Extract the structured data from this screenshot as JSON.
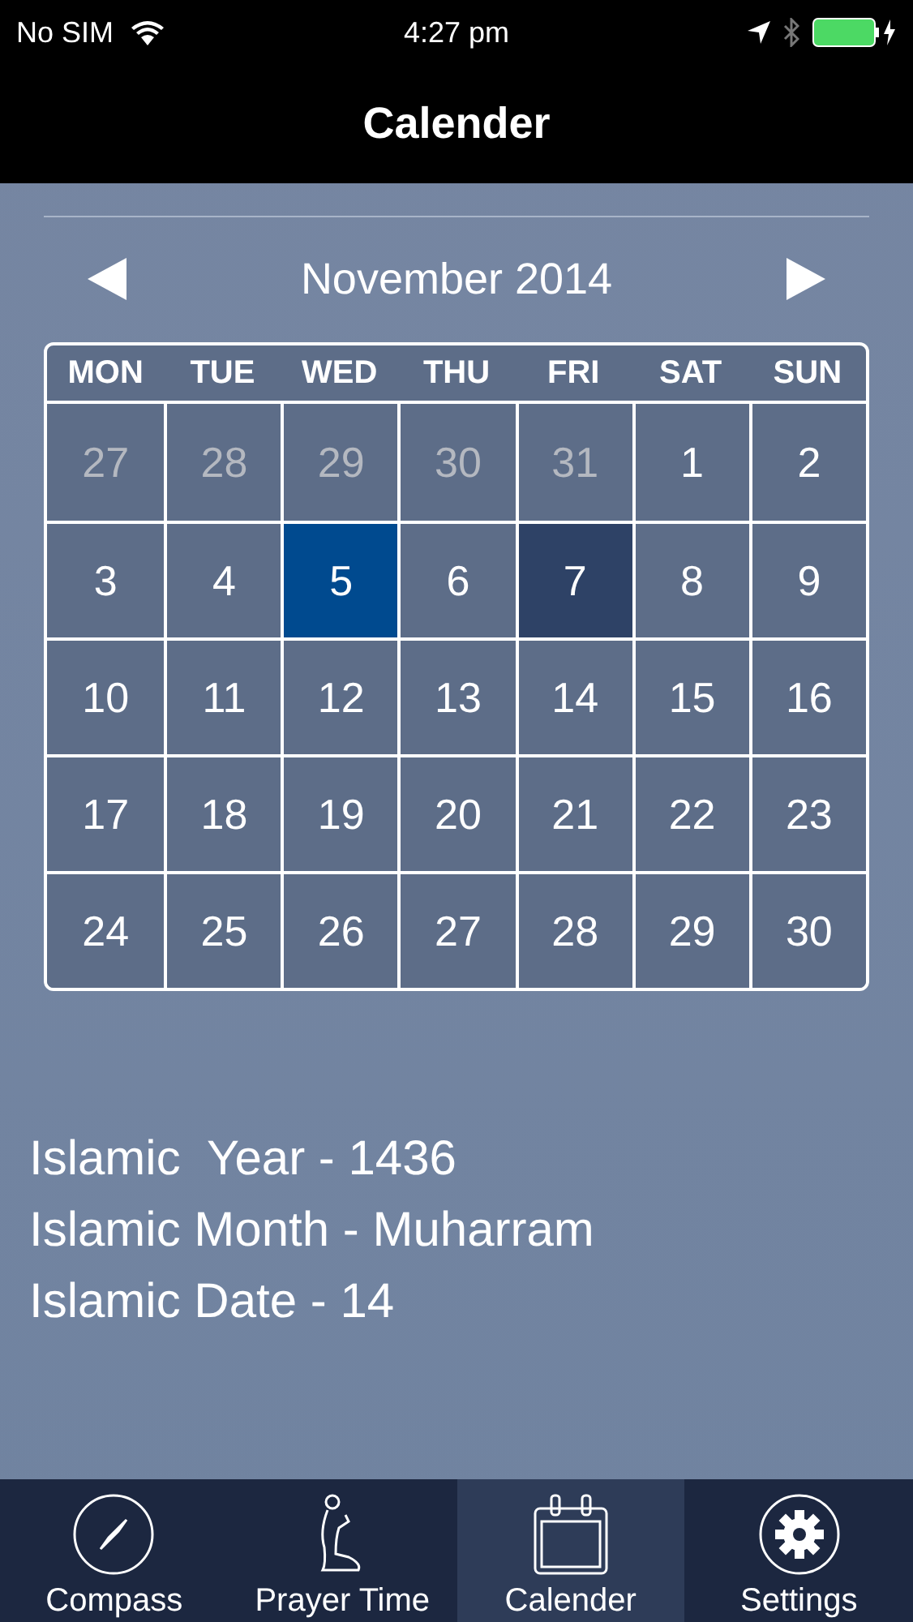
{
  "status_bar": {
    "carrier": "No SIM",
    "time": "4:27 pm"
  },
  "nav_bar": {
    "title": "Calender"
  },
  "calendar": {
    "month": "November 2014",
    "weekdays": [
      "MON",
      "TUE",
      "WED",
      "THU",
      "FRI",
      "SAT",
      "SUN"
    ],
    "days": [
      {
        "label": "27",
        "kind": "outside",
        "today": false,
        "selected": false
      },
      {
        "label": "28",
        "kind": "outside",
        "today": false,
        "selected": false
      },
      {
        "label": "29",
        "kind": "outside",
        "today": false,
        "selected": false
      },
      {
        "label": "30",
        "kind": "outside",
        "today": false,
        "selected": false
      },
      {
        "label": "31",
        "kind": "outside",
        "today": false,
        "selected": false
      },
      {
        "label": "1",
        "kind": "current",
        "today": false,
        "selected": false
      },
      {
        "label": "2",
        "kind": "current",
        "today": false,
        "selected": false
      },
      {
        "label": "3",
        "kind": "current",
        "today": false,
        "selected": false
      },
      {
        "label": "4",
        "kind": "current",
        "today": false,
        "selected": false
      },
      {
        "label": "5",
        "kind": "current",
        "today": true,
        "selected": false
      },
      {
        "label": "6",
        "kind": "current",
        "today": false,
        "selected": false
      },
      {
        "label": "7",
        "kind": "current",
        "today": false,
        "selected": true
      },
      {
        "label": "8",
        "kind": "current",
        "today": false,
        "selected": false
      },
      {
        "label": "9",
        "kind": "current",
        "today": false,
        "selected": false
      },
      {
        "label": "10",
        "kind": "current",
        "today": false,
        "selected": false
      },
      {
        "label": "11",
        "kind": "current",
        "today": false,
        "selected": false
      },
      {
        "label": "12",
        "kind": "current",
        "today": false,
        "selected": false
      },
      {
        "label": "13",
        "kind": "current",
        "today": false,
        "selected": false
      },
      {
        "label": "14",
        "kind": "current",
        "today": false,
        "selected": false
      },
      {
        "label": "15",
        "kind": "current",
        "today": false,
        "selected": false
      },
      {
        "label": "16",
        "kind": "current",
        "today": false,
        "selected": false
      },
      {
        "label": "17",
        "kind": "current",
        "today": false,
        "selected": false
      },
      {
        "label": "18",
        "kind": "current",
        "today": false,
        "selected": false
      },
      {
        "label": "19",
        "kind": "current",
        "today": false,
        "selected": false
      },
      {
        "label": "20",
        "kind": "current",
        "today": false,
        "selected": false
      },
      {
        "label": "21",
        "kind": "current",
        "today": false,
        "selected": false
      },
      {
        "label": "22",
        "kind": "current",
        "today": false,
        "selected": false
      },
      {
        "label": "23",
        "kind": "current",
        "today": false,
        "selected": false
      },
      {
        "label": "24",
        "kind": "current",
        "today": false,
        "selected": false
      },
      {
        "label": "25",
        "kind": "current",
        "today": false,
        "selected": false
      },
      {
        "label": "26",
        "kind": "current",
        "today": false,
        "selected": false
      },
      {
        "label": "27",
        "kind": "current",
        "today": false,
        "selected": false
      },
      {
        "label": "28",
        "kind": "current",
        "today": false,
        "selected": false
      },
      {
        "label": "29",
        "kind": "current",
        "today": false,
        "selected": false
      },
      {
        "label": "30",
        "kind": "current",
        "today": false,
        "selected": false
      }
    ]
  },
  "islamic_info": [
    "Islamic  Year - 1436",
    "Islamic Month - Muharram",
    "Islamic Date - 14"
  ],
  "tab_bar": [
    {
      "label": "Compass",
      "kind": "compass",
      "selected": false
    },
    {
      "label": "Prayer Time",
      "kind": "prayer",
      "selected": false
    },
    {
      "label": "Calender",
      "kind": "calendar",
      "selected": true
    },
    {
      "label": "Settings",
      "kind": "settings",
      "selected": false
    }
  ]
}
